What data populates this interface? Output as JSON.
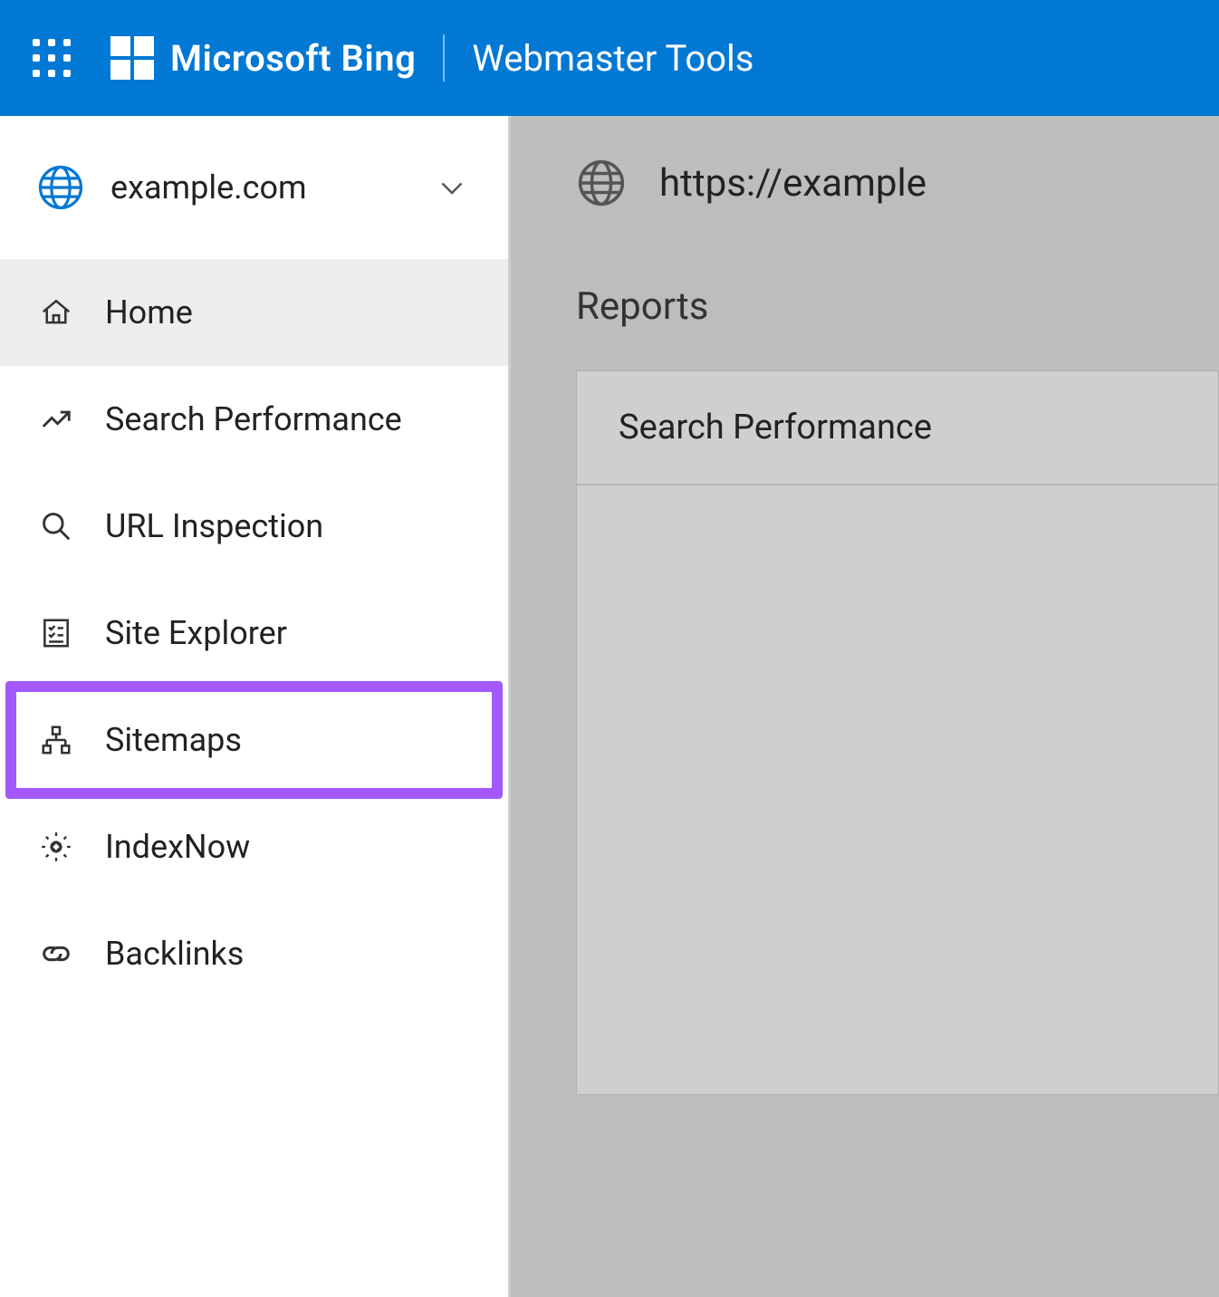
{
  "header": {
    "brand": "Microsoft Bing",
    "subtitle": "Webmaster Tools"
  },
  "sidebar": {
    "site_name": "example.com",
    "items": [
      {
        "label": "Home",
        "icon": "home-icon",
        "active": true
      },
      {
        "label": "Search Performance",
        "icon": "trend-icon"
      },
      {
        "label": "URL Inspection",
        "icon": "search-icon"
      },
      {
        "label": "Site Explorer",
        "icon": "checklist-icon"
      },
      {
        "label": "Sitemaps",
        "icon": "sitemap-icon",
        "highlighted": true
      },
      {
        "label": "IndexNow",
        "icon": "gear-icon"
      },
      {
        "label": "Backlinks",
        "icon": "link-icon"
      }
    ]
  },
  "main": {
    "site_url": "https://example",
    "section_heading": "Reports",
    "card_title": "Search Performance"
  }
}
